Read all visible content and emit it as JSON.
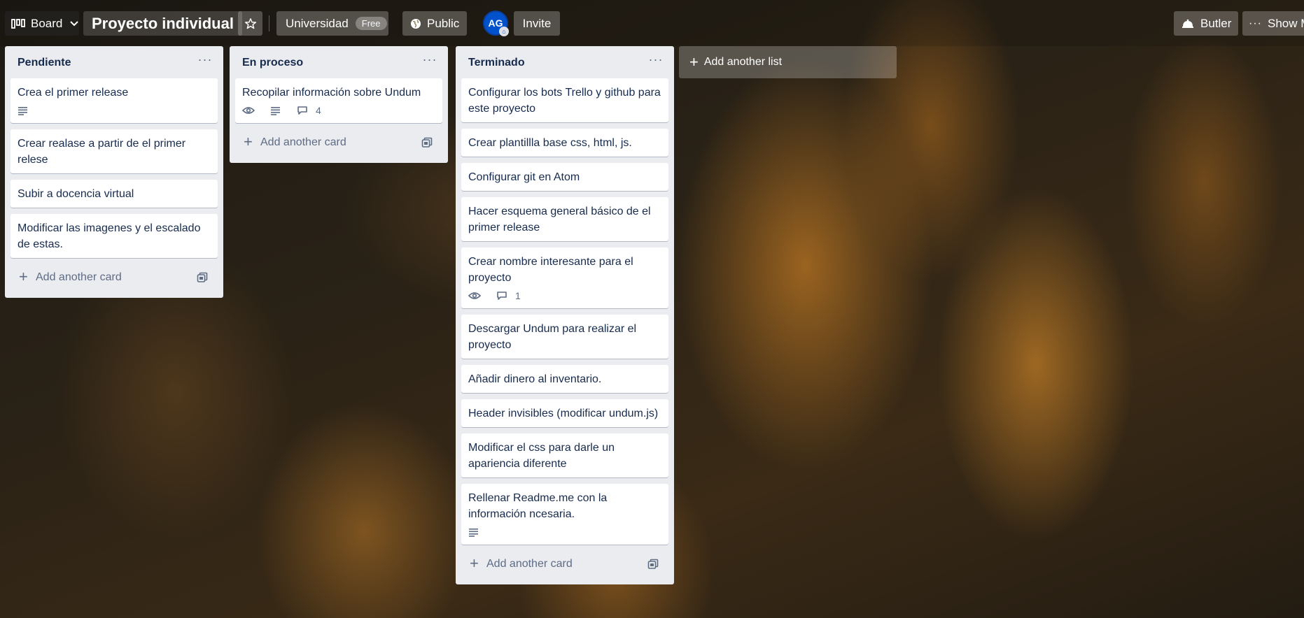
{
  "header": {
    "board_view": "Board",
    "title": "Proyecto individual",
    "workspace": "Universidad",
    "workspace_badge": "Free",
    "visibility": "Public",
    "avatar_initials": "AG",
    "invite": "Invite",
    "butler": "Butler",
    "show_menu": "Show M"
  },
  "lists": [
    {
      "title": "Pendiente",
      "add_card": "Add another card",
      "cards": [
        {
          "text": "Crea el primer release",
          "description": true
        },
        {
          "text": "Crear realase a partir de el primer relese"
        },
        {
          "text": "Subir a docencia virtual"
        },
        {
          "text": "Modificar las imagenes y el escalado de estas."
        }
      ]
    },
    {
      "title": "En proceso",
      "add_card": "Add another card",
      "cards": [
        {
          "text": "Recopilar información sobre Undum",
          "watch": true,
          "description": true,
          "comments": "4"
        }
      ]
    },
    {
      "title": "Terminado",
      "add_card": "Add another card",
      "cards": [
        {
          "text": "Configurar los bots Trello y github para este proyecto"
        },
        {
          "text": "Crear plantillla base css, html, js."
        },
        {
          "text": "Configurar git en Atom"
        },
        {
          "text": "Hacer esquema general básico de el primer release"
        },
        {
          "text": "Crear nombre interesante para el proyecto",
          "watch": true,
          "comments": "1"
        },
        {
          "text": "Descargar Undum para realizar el proyecto"
        },
        {
          "text": "Añadir dinero al inventario."
        },
        {
          "text": "Header invisibles (modificar undum.js)"
        },
        {
          "text": "Modificar el css para darle un apariencia diferente"
        },
        {
          "text": "Rellenar Readme.me con la información ncesaria.",
          "description": true
        }
      ]
    }
  ],
  "add_list": "Add another list",
  "icons": {
    "board": "board-icon",
    "chevron": "chevron-down-icon",
    "star": "star-icon",
    "globe": "globe-icon",
    "butler": "butler-bell-icon",
    "more": "more-dots-icon",
    "description": "description-icon",
    "watch": "eye-icon",
    "comment": "comment-icon",
    "template": "card-template-icon"
  }
}
